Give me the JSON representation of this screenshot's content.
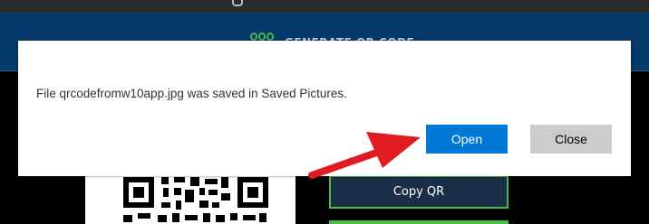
{
  "header": {
    "title": "GENERATE QR CODE",
    "icon": "qr-generate-icon"
  },
  "main": {
    "copy_qr_label": "Copy QR"
  },
  "dialog": {
    "message": "File qrcodefromw10app.jpg was saved in Saved Pictures.",
    "open_label": "Open",
    "close_label": "Close"
  },
  "colors": {
    "header_bg": "#063a6b",
    "accent": "#0078d7",
    "green": "#4dbd4a",
    "arrow": "#e11b22"
  }
}
